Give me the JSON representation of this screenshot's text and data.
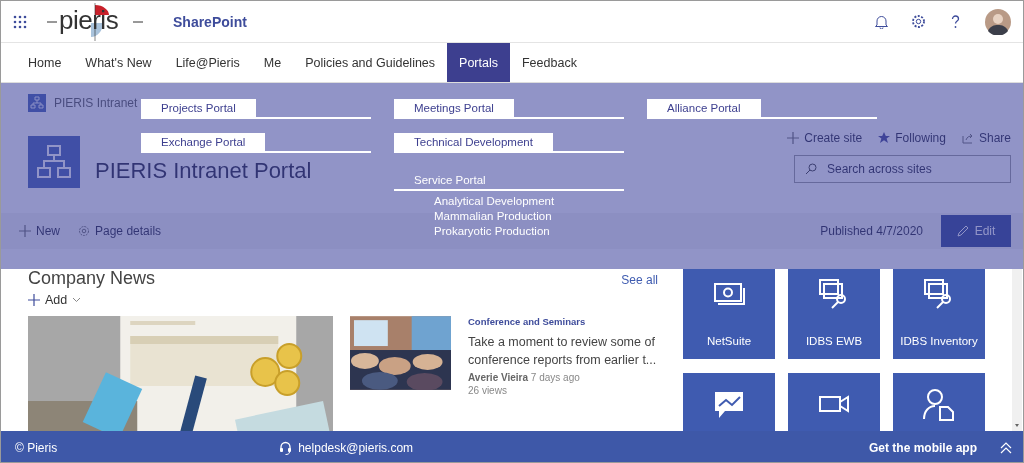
{
  "top_bar": {
    "logo_text": "pieris",
    "app_name": "SharePoint"
  },
  "nav": {
    "tabs": [
      {
        "label": "Home",
        "selected": false
      },
      {
        "label": "What's New",
        "selected": false
      },
      {
        "label": "Life@Pieris",
        "selected": false
      },
      {
        "label": "Me",
        "selected": false
      },
      {
        "label": "Policies and Guidelines",
        "selected": false
      },
      {
        "label": "Portals",
        "selected": true
      },
      {
        "label": "Feedback",
        "selected": false
      }
    ]
  },
  "site_header": {
    "breadcrumb": "PIERIS Intranet",
    "title": "PIERIS Intranet Portal",
    "actions": [
      {
        "label": "Create site",
        "kind": "add"
      },
      {
        "label": "Following",
        "kind": "star"
      },
      {
        "label": "Share",
        "kind": "share"
      }
    ],
    "search": {
      "placeholder": "Search across sites"
    },
    "command_bar": {
      "new": "New",
      "page_details": "Page details",
      "published": "Published 4/7/2020",
      "edit": "Edit"
    }
  },
  "mega_menu": {
    "columns": [
      {
        "items": [
          {
            "label": "Projects Portal",
            "kind": "boxed"
          },
          {
            "label": "Exchange Portal",
            "kind": "boxed"
          }
        ]
      },
      {
        "items": [
          {
            "label": "Meetings Portal",
            "kind": "boxed"
          },
          {
            "label": "Technical Development",
            "kind": "boxed"
          },
          {
            "label": "Service Portal",
            "kind": "plain",
            "children": [
              {
                "label": "Analytical Development"
              },
              {
                "label": "Mammalian Production"
              },
              {
                "label": "Prokaryotic Production"
              }
            ]
          }
        ]
      },
      {
        "items": [
          {
            "label": "Alliance Portal",
            "kind": "boxed"
          }
        ]
      }
    ]
  },
  "news": {
    "title": "Company News",
    "see_all": "See all",
    "add": "Add",
    "article": {
      "category": "Conference and Seminars",
      "title": "Take a moment to review some of conference reports from earlier t...",
      "author": "Averie Vieira",
      "time": "7 days ago",
      "views": "26 views"
    }
  },
  "quick_links": [
    {
      "label": "NetSuite",
      "kind": "money"
    },
    {
      "label": "IDBS EWB",
      "kind": "window-search"
    },
    {
      "label": "IDBS Inventory",
      "kind": "window-search"
    },
    {
      "kind": "chat-chart"
    },
    {
      "kind": "video"
    },
    {
      "kind": "person-doc"
    }
  ],
  "footer": {
    "copyright": "© Pieris",
    "helpdesk": "helpdesk@pieris.com",
    "mobile_app": "Get the mobile app"
  }
}
